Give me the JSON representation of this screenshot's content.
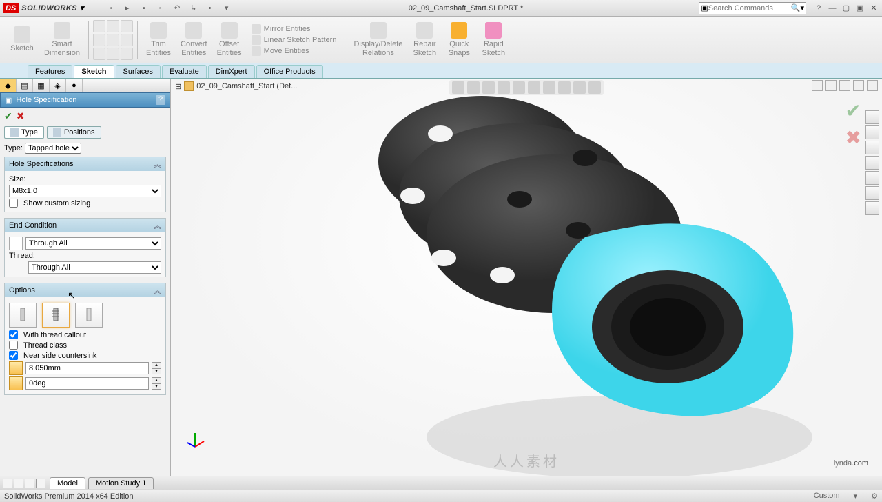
{
  "app": {
    "brand_ds": "DS",
    "brand_sw": "SOLIDWORKS"
  },
  "title": "02_09_Camshaft_Start.SLDPRT *",
  "search": {
    "placeholder": "Search Commands"
  },
  "ribbon": {
    "sketch": "Sketch",
    "smart_dim": "Smart\nDimension",
    "trim": "Trim\nEntities",
    "convert": "Convert\nEntities",
    "offset": "Offset\nEntities",
    "mirror": "Mirror Entities",
    "pattern": "Linear Sketch Pattern",
    "move": "Move Entities",
    "display": "Display/Delete\nRelations",
    "repair": "Repair\nSketch",
    "quick": "Quick\nSnaps",
    "rapid": "Rapid\nSketch"
  },
  "tabs": {
    "features": "Features",
    "sketch": "Sketch",
    "surfaces": "Surfaces",
    "evaluate": "Evaluate",
    "dimxpert": "DimXpert",
    "office": "Office Products"
  },
  "crumb": "02_09_Camshaft_Start  (Def...",
  "pm": {
    "title": "Hole Specification",
    "tab_type": "Type",
    "tab_positions": "Positions",
    "type_label": "Type:",
    "type_value": "Tapped hole",
    "sec_holespec": "Hole Specifications",
    "size_label": "Size:",
    "size_value": "M8x1.0",
    "show_custom": "Show custom sizing",
    "sec_endcond": "End Condition",
    "endcond_value": "Through All",
    "thread_label": "Thread:",
    "thread_value": "Through All",
    "sec_options": "Options",
    "with_callout": "With thread callout",
    "thread_class": "Thread class",
    "near_cs": "Near side countersink",
    "cs_depth": "8.050mm",
    "cs_angle": "0deg"
  },
  "bottom": {
    "model": "Model",
    "motion": "Motion Study 1"
  },
  "status": {
    "left": "SolidWorks Premium 2014 x64 Edition",
    "custom": "Custom"
  },
  "watermark": {
    "a": "lynda",
    "b": ".com",
    "c": "人人素材"
  }
}
